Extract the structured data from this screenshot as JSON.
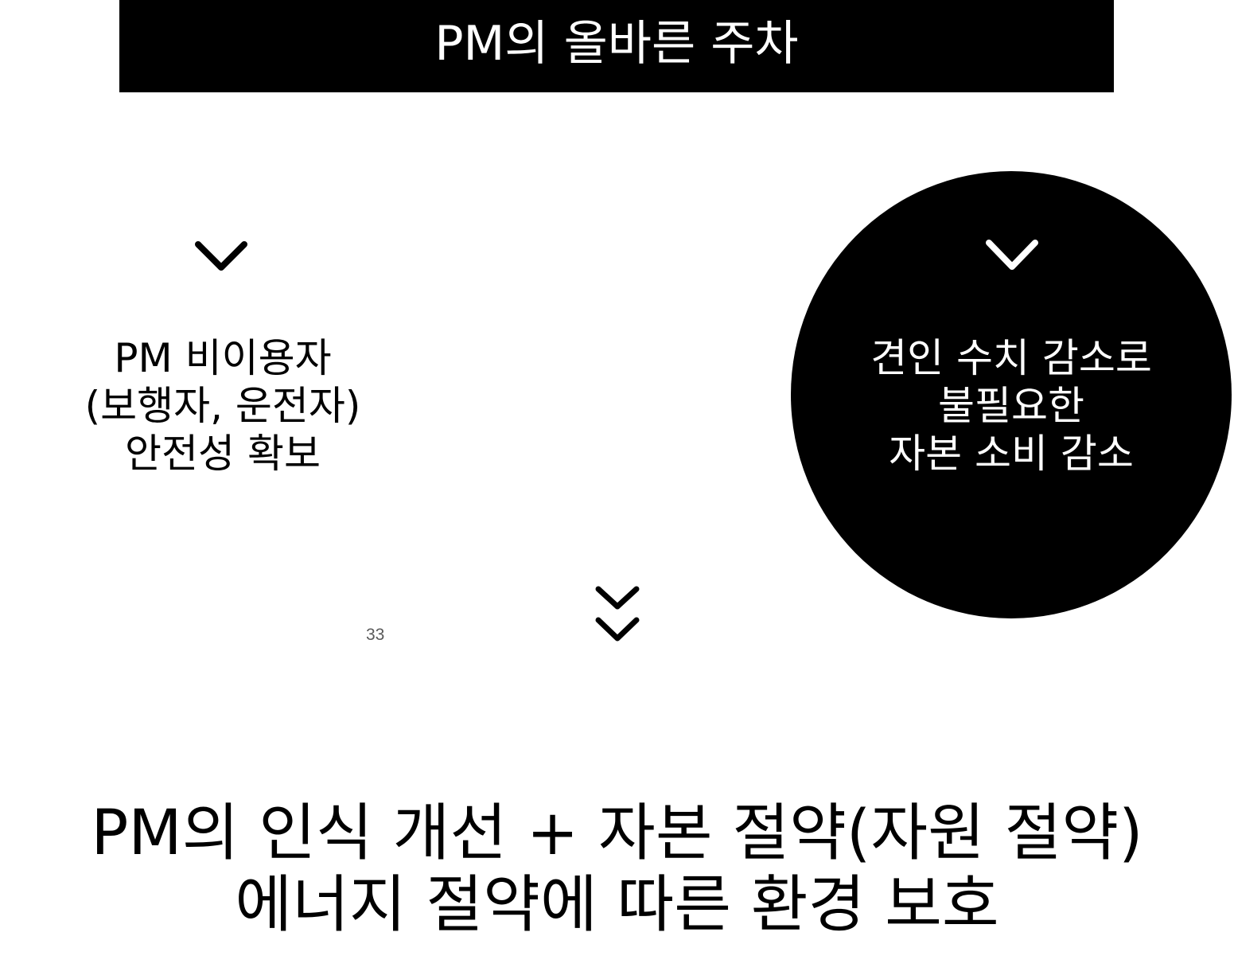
{
  "slide": {
    "title": "PM의 올바른 주차",
    "left_item": {
      "lines": [
        "PM 비이용자",
        "(보행자, 운전자)",
        "안전성 확보"
      ]
    },
    "circle_item": {
      "lines": [
        "견인 수치 감소로",
        "불필요한",
        "자본 소비 감소"
      ]
    },
    "page_number": "33",
    "conclusion": {
      "lines": [
        "PM의 인식 개선 + 자본 절약(자원 절약)",
        "에너지 절약에 따른 환경 보호"
      ]
    }
  },
  "icons": {
    "left_chevron": "chevron-down-icon",
    "circle_chevron": "chevron-down-icon",
    "center_double_chevron": "double-chevron-down-icon"
  },
  "colors": {
    "background": "#ffffff",
    "title_bar": "#000000",
    "title_text": "#ffffff",
    "circle": "#000000",
    "circle_text": "#ffffff",
    "page_number": "#595959"
  }
}
